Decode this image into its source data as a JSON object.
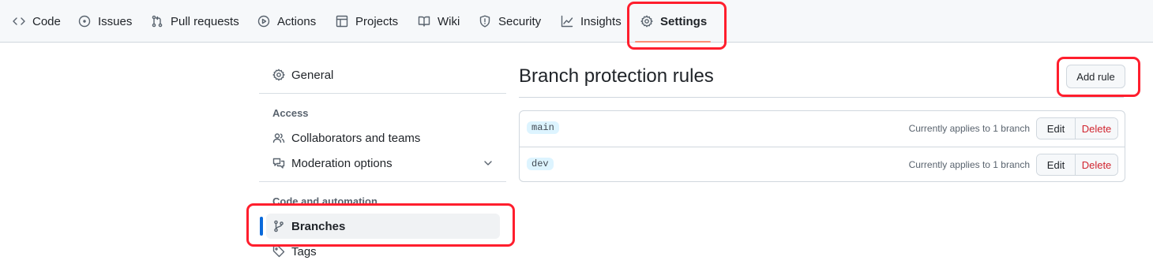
{
  "tabs": [
    {
      "key": "code",
      "label": "Code",
      "icon": "code-icon"
    },
    {
      "key": "issues",
      "label": "Issues",
      "icon": "issue-opened-icon"
    },
    {
      "key": "pulls",
      "label": "Pull requests",
      "icon": "git-pull-request-icon"
    },
    {
      "key": "actions",
      "label": "Actions",
      "icon": "play-icon"
    },
    {
      "key": "projects",
      "label": "Projects",
      "icon": "table-icon"
    },
    {
      "key": "wiki",
      "label": "Wiki",
      "icon": "book-icon"
    },
    {
      "key": "security",
      "label": "Security",
      "icon": "shield-icon"
    },
    {
      "key": "insights",
      "label": "Insights",
      "icon": "graph-icon"
    },
    {
      "key": "settings",
      "label": "Settings",
      "icon": "gear-icon",
      "selected": true
    }
  ],
  "sidebar": {
    "general": {
      "label": "General",
      "icon": "gear-icon"
    },
    "access_heading": "Access",
    "collaborators": {
      "label": "Collaborators and teams",
      "icon": "people-icon"
    },
    "moderation": {
      "label": "Moderation options",
      "icon": "comment-discussion-icon",
      "expander": "chevron-down-icon"
    },
    "code_heading": "Code and automation",
    "branches": {
      "label": "Branches",
      "icon": "git-branch-icon",
      "active": true
    },
    "tags": {
      "label": "Tags",
      "icon": "tag-icon"
    }
  },
  "main": {
    "title": "Branch protection rules",
    "add_rule_label": "Add rule",
    "rules": [
      {
        "branch": "main",
        "applies": "Currently applies to 1 branch",
        "edit_label": "Edit",
        "delete_label": "Delete"
      },
      {
        "branch": "dev",
        "applies": "Currently applies to 1 branch",
        "edit_label": "Edit",
        "delete_label": "Delete"
      }
    ]
  },
  "colors": {
    "highlight": "#ff1e2d",
    "accent": "#0969da",
    "tab_underline": "#fd8c73",
    "danger": "#d1242f"
  }
}
